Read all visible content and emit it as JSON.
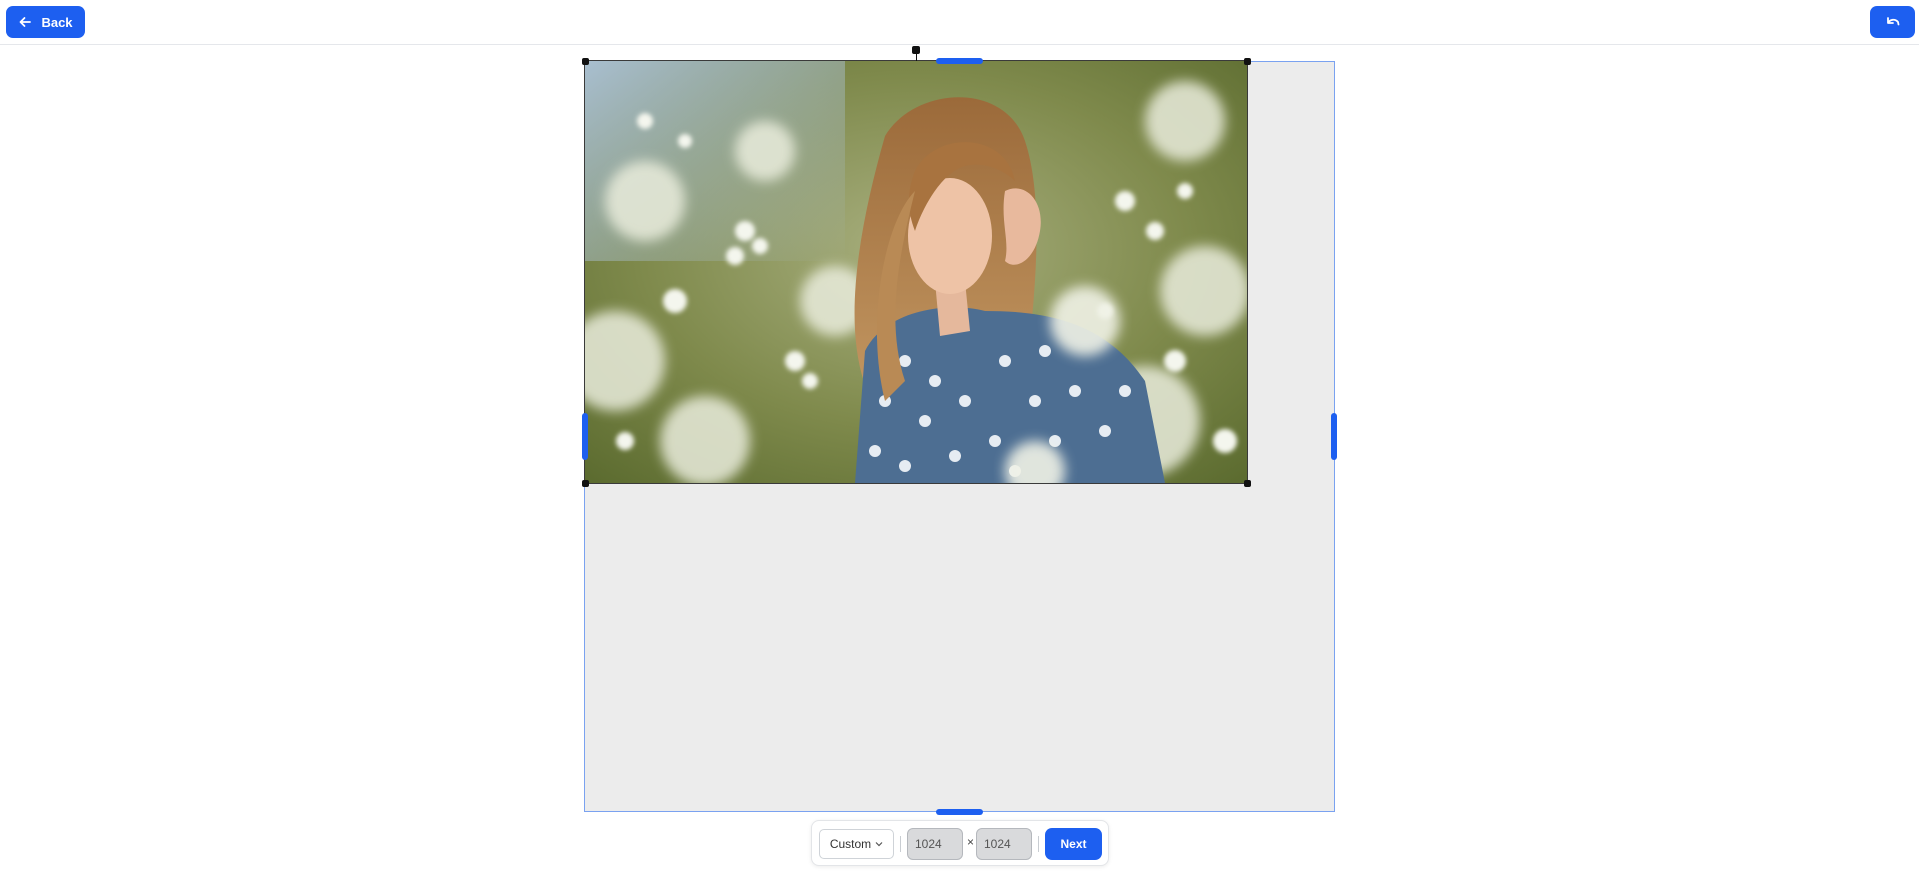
{
  "header": {
    "back_label": "Back",
    "back_icon": "arrow-left-icon",
    "undo_icon": "undo-icon"
  },
  "canvas": {
    "background_color": "#ececec",
    "frame_color": "#7aa2f0",
    "image_description_icon": "photo"
  },
  "toolbar": {
    "preset_value": "Custom",
    "width_value": "1024",
    "height_value": "1024",
    "times_symbol": "×",
    "next_label": "Next"
  },
  "colors": {
    "accent": "#1d5ff0"
  }
}
